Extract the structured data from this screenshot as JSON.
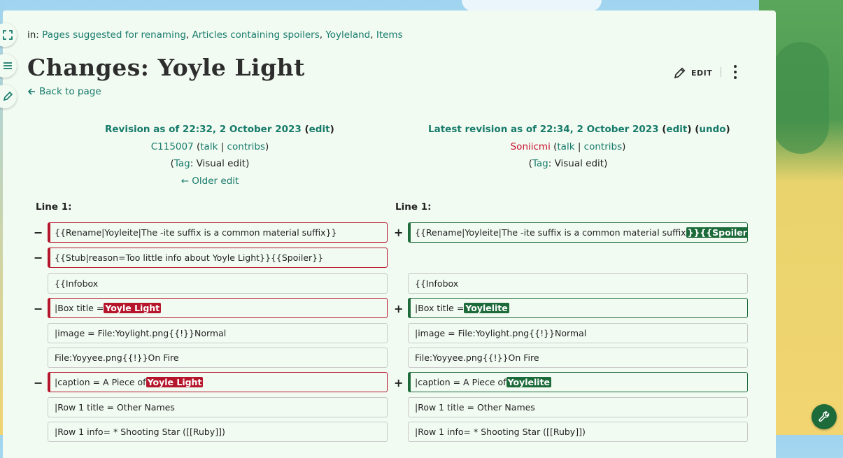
{
  "categories": {
    "label": "in:",
    "items": [
      "Pages suggested for renaming",
      "Articles containing spoilers",
      "Yoyleland",
      "Items"
    ]
  },
  "page": {
    "title": "Changes: Yoyle Light",
    "back_link": "Back to page",
    "edit_label": "EDIT"
  },
  "old_revision": {
    "heading": "Revision as of 22:32, 2 October 2023",
    "edit": "edit",
    "user": "C115007",
    "talk": "talk",
    "contribs": "contribs",
    "tag_label": "Tag",
    "tag_value": ": Visual edit",
    "older_edit": "← Older edit"
  },
  "new_revision": {
    "heading": "Latest revision as of 22:34, 2 October 2023",
    "edit": "edit",
    "undo": "undo",
    "user": "Soniicmi",
    "talk": "talk",
    "contribs": "contribs",
    "tag_label": "Tag",
    "tag_value": ": Visual edit"
  },
  "diff": {
    "line_label": "Line 1:",
    "del_mark": "−",
    "add_mark": "+",
    "rows": [
      {
        "left": "{{Rename|Yoyleite|The -ite suffix is a common material suffix}}",
        "right_pre": "{{Rename|Yoyleite|The -ite suffix is a common material suffix",
        "right_hl": "}}{{Spoiler",
        "right_post": "}}"
      },
      {
        "left": "{{Stub|reason=Too little info about Yoyle Light}}{{Spoiler}}"
      },
      {
        "left": "{{Infobox",
        "right": "{{Infobox"
      },
      {
        "left_pre": "|Box title = ",
        "left_hl": "Yoyle Light",
        "right_pre": "|Box title = ",
        "right_hl": "Yoylelite"
      },
      {
        "left": "|image = File:Yoylight.png{{!}}Normal",
        "right": "|image = File:Yoylight.png{{!}}Normal"
      },
      {
        "left": "File:Yoyyee.png{{!}}On Fire",
        "right": "File:Yoyyee.png{{!}}On Fire"
      },
      {
        "left_pre": "|caption = A Piece of ",
        "left_hl": "Yoyle Light",
        "right_pre": "|caption = A Piece of ",
        "right_hl": "Yoylelite"
      },
      {
        "left": "|Row 1 title = Other Names",
        "right": "|Row 1 title = Other Names"
      },
      {
        "left": "|Row 1 info= * Shooting Star ([[Ruby]])",
        "right": "|Row 1 info= * Shooting Star ([[Ruby]])"
      }
    ]
  },
  "colors": {
    "link": "#167a6a",
    "deleted": "#b5162c",
    "added": "#1d6b3a",
    "content_bg": "#f2fbf2"
  },
  "icons": [
    "fullscreen-icon",
    "menu-icon",
    "pencil-icon",
    "back-arrow-icon",
    "edit-pencil-icon",
    "more-vertical-icon",
    "wrench-icon"
  ]
}
